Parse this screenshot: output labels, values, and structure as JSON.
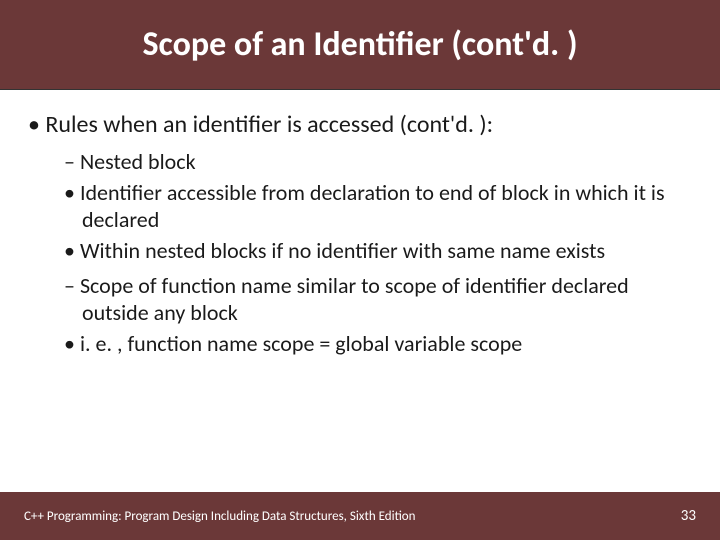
{
  "title": "Scope of an Identifier (cont'd. )",
  "bullets": {
    "top": "Rules when an identifier is accessed (cont'd. ):",
    "dash1": "Nested block",
    "dot1": "Identifier accessible from declaration to end of block in which it is declared",
    "dot2": "Within nested blocks if no identifier with same name exists",
    "dash2": "Scope of function name similar to scope of identifier declared outside any block",
    "dot3": "i. e. , function name scope = global variable scope"
  },
  "footer": {
    "source": "C++ Programming: Program Design Including Data Structures, Sixth Edition",
    "page": "33"
  },
  "colors": {
    "bar": "#6b3838",
    "text": "#1a1a1a",
    "footerText": "#ffffff"
  }
}
